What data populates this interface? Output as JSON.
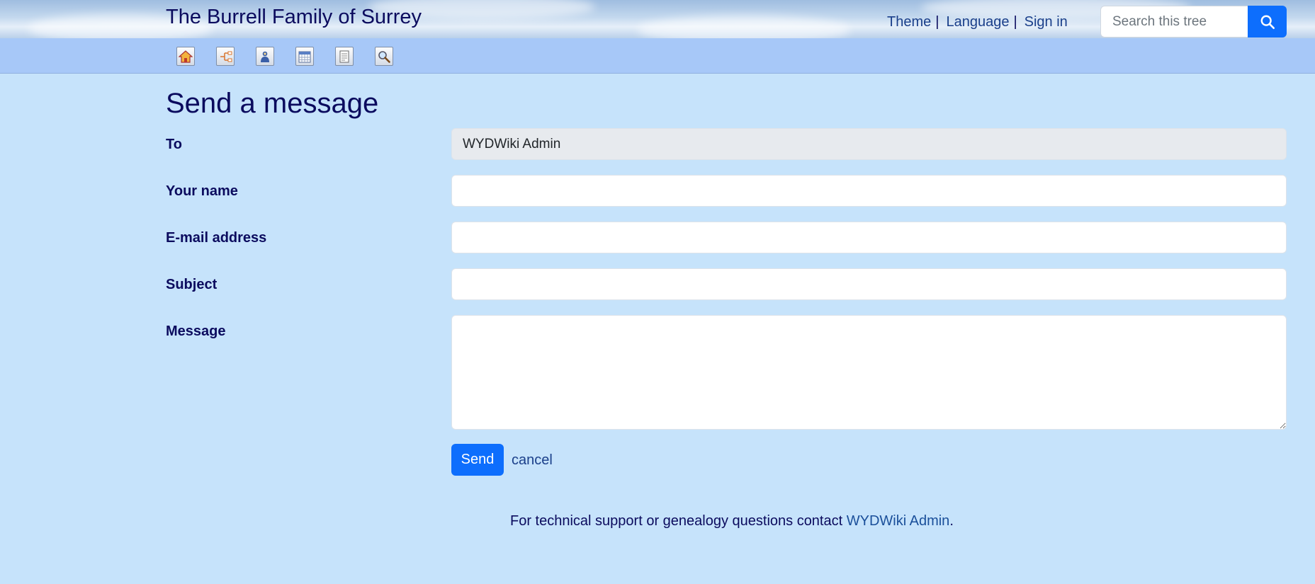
{
  "header": {
    "site_title": "The Burrell Family of Surrey",
    "links": {
      "theme": "Theme",
      "language": "Language",
      "sign_in": "Sign in",
      "separator": "|"
    },
    "search": {
      "placeholder": "Search this tree",
      "button_icon": "search-icon"
    }
  },
  "menu": {
    "icons": [
      "home-icon",
      "chart-icon",
      "individual-icon",
      "calendar-icon",
      "report-icon",
      "search-icon"
    ]
  },
  "main": {
    "title": "Send a message",
    "fields": {
      "to_label": "To",
      "to_value": "WYDWiki Admin",
      "name_label": "Your name",
      "name_value": "",
      "email_label": "E-mail address",
      "email_value": "",
      "subject_label": "Subject",
      "subject_value": "",
      "message_label": "Message",
      "message_value": ""
    },
    "send_label": "Send",
    "cancel_label": "cancel"
  },
  "footer": {
    "text": "For technical support or genealogy questions contact ",
    "link": "WYDWiki Admin",
    "suffix": "."
  },
  "colors": {
    "page_bg": "#c6e3fb",
    "menubar_bg": "#a7c8f8",
    "primary_button": "#0d6efd",
    "title_text": "#0b0b5e"
  }
}
